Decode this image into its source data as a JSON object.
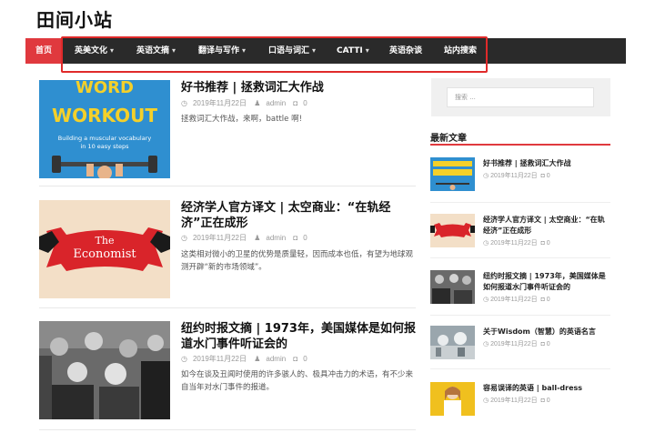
{
  "site": {
    "title": "田间小站"
  },
  "nav": {
    "items": [
      {
        "label": "首页",
        "has_dropdown": false,
        "active": true
      },
      {
        "label": "英美文化",
        "has_dropdown": true
      },
      {
        "label": "英语文摘",
        "has_dropdown": true
      },
      {
        "label": "翻译与写作",
        "has_dropdown": true
      },
      {
        "label": "口语与词汇",
        "has_dropdown": true
      },
      {
        "label": "CATTI",
        "has_dropdown": true
      },
      {
        "label": "英语杂谈",
        "has_dropdown": false
      },
      {
        "label": "站内搜索",
        "has_dropdown": false
      }
    ],
    "chevron": "▾",
    "active_color": "#e0393e",
    "bg_color": "#2a2a2a",
    "highlight_color": "#e02a2a"
  },
  "posts": [
    {
      "title": "好书推荐 | 拯救词汇大作战",
      "date": "2019年11月22日",
      "author": "admin",
      "comments": "0",
      "excerpt": "拯救词汇大作战，来啊，battle 啊!",
      "thumb": {
        "line1": "WORD",
        "line2": "WORKOUT",
        "sub1": "Building a muscular vocabulary",
        "sub2": "in 10 easy steps"
      }
    },
    {
      "title": "经济学人官方译文 | 太空商业：“在轨经济”正在成形",
      "date": "2019年11月22日",
      "author": "admin",
      "comments": "0",
      "excerpt": "这类相对微小的卫星的优势是质量轻，因而成本也低，有望为地球观测开辟“新的市场领域”。",
      "thumb": {
        "line1": "The",
        "line2": "Economist"
      }
    },
    {
      "title": "纽约时报文摘 | 1973年，美国媒体是如何报道水门事件听证会的",
      "date": "2019年11月22日",
      "author": "admin",
      "comments": "0",
      "excerpt": "如今在谈及丑闻时使用的许多骇人的、极具冲击力的术语，有不少来自当年对水门事件的报道。"
    }
  ],
  "sidebar": {
    "search_placeholder": "搜索 ...",
    "recent_heading": "最新文章",
    "items": [
      {
        "title": "好书推荐 | 拯救词汇大作战",
        "date": "2019年11月22日",
        "comments": "0"
      },
      {
        "title": "经济学人官方译文 | 太空商业：“在轨经济”正在成形",
        "date": "2019年11月22日",
        "comments": "0"
      },
      {
        "title": "纽约时报文摘 | 1973年，美国媒体是如何报道水门事件听证会的",
        "date": "2019年11月22日",
        "comments": "0"
      },
      {
        "title": "关于Wisdom（智慧）的英语名言",
        "date": "2019年11月22日",
        "comments": "0"
      },
      {
        "title": "容易误译的英语 | ball-dress",
        "date": "2019年11月22日",
        "comments": "0"
      }
    ]
  },
  "icons": {
    "clock": "clock-icon",
    "user": "user-icon",
    "comment": "comment-icon"
  }
}
